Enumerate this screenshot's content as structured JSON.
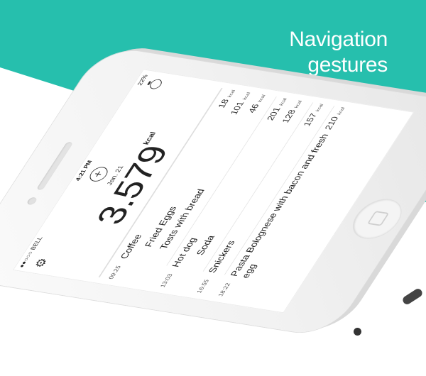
{
  "headline": [
    "Navigation",
    "gestures"
  ],
  "colors": {
    "accent": "#26bfad",
    "text": "#222222"
  },
  "status": {
    "carrier": "●●○○○ BELL",
    "time": "4:21 PM",
    "battery": "22%"
  },
  "icons": {
    "settings": "gear-icon",
    "add": "plus-circle-icon",
    "timer": "stopwatch-icon"
  },
  "day": {
    "date": "Jan. 21",
    "total": "3.579",
    "unit": "kcal"
  },
  "entries": [
    {
      "time": "09:25",
      "name": "Coffee",
      "kcal": "18",
      "unit": "kcal"
    },
    {
      "time": "",
      "name": "Fried Eggs",
      "kcal": "101",
      "unit": "kcal"
    },
    {
      "time": "",
      "name": "Tosts with bread",
      "kcal": "46",
      "unit": "kcal"
    },
    {
      "time": "13:03",
      "name": "Hot dog",
      "kcal": "201",
      "unit": "kcal"
    },
    {
      "time": "",
      "name": "Soda",
      "kcal": "128",
      "unit": "kcal"
    },
    {
      "time": "16:55",
      "name": "Snickers",
      "kcal": "157",
      "unit": "kcal"
    },
    {
      "time": "18:22",
      "name": "Pasta Bolognese with bacon and fresh egg",
      "kcal": "210",
      "unit": "kcal"
    }
  ]
}
